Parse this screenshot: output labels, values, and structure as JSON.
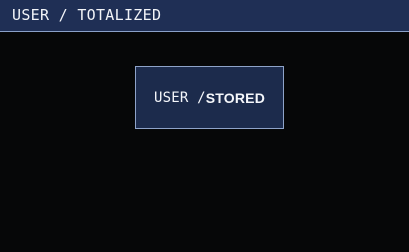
{
  "header": {
    "title": "USER / TOTALIZED"
  },
  "menu": {
    "stored_box": {
      "prefix": "USER / ",
      "label": "STORED"
    }
  },
  "colors": {
    "background": "#060708",
    "header_bg": "#1f2f55",
    "box_bg": "#1c2b4c",
    "border": "#8ea3c9",
    "text": "#f5f7fb"
  }
}
